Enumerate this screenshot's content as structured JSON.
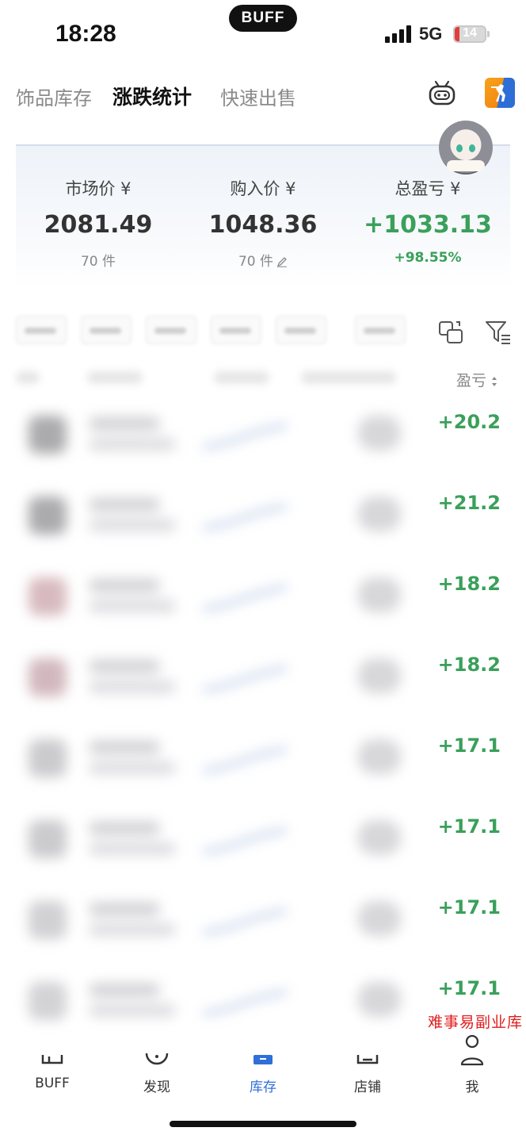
{
  "status_bar": {
    "time": "18:28",
    "island_text": "BUFF",
    "network": "5G",
    "battery": "14"
  },
  "tabs": [
    {
      "label": "饰品库存",
      "active": false
    },
    {
      "label": "涨跌统计",
      "active": true
    },
    {
      "label": "快速出售",
      "active": false
    }
  ],
  "header_icons": {
    "robot": "robot-icon",
    "game": "csgo-game-icon"
  },
  "summary": {
    "market": {
      "label": "市场价 ¥",
      "value": "2081.49",
      "count": "70 件"
    },
    "purchase": {
      "label": "购入价 ¥",
      "value": "1048.36",
      "count": "70 件"
    },
    "profit": {
      "label": "总盈亏 ¥",
      "value": "+1033.13",
      "percent": "+98.55%"
    }
  },
  "list": {
    "sort_label": "盈亏",
    "rows": [
      {
        "pnl": "+20.2"
      },
      {
        "pnl": "+21.2"
      },
      {
        "pnl": "+18.2"
      },
      {
        "pnl": "+18.2"
      },
      {
        "pnl": "+17.1"
      },
      {
        "pnl": "+17.1"
      },
      {
        "pnl": "+17.1"
      },
      {
        "pnl": "+17.1"
      }
    ]
  },
  "watermark": "难事易副业库",
  "bottom_nav": [
    {
      "label": "BUFF",
      "icon": "buff-home-icon",
      "active": false
    },
    {
      "label": "发现",
      "icon": "discover-icon",
      "active": false
    },
    {
      "label": "库存",
      "icon": "inventory-icon",
      "active": true
    },
    {
      "label": "店铺",
      "icon": "shop-icon",
      "active": false
    },
    {
      "label": "我",
      "icon": "profile-icon",
      "active": false
    }
  ],
  "colors": {
    "profit_green": "#3aa05a",
    "accent_blue": "#2f6fd8",
    "watermark_red": "#e01c1c"
  }
}
